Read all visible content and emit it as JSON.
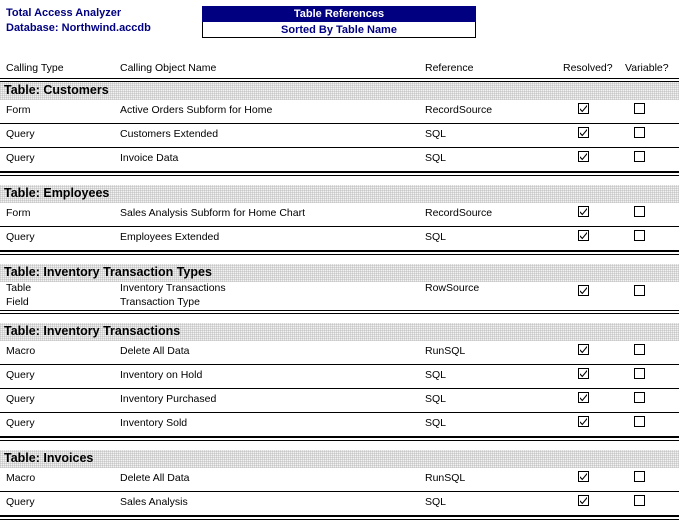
{
  "header": {
    "product": "Total Access Analyzer",
    "database": "Database: Northwind.accdb",
    "title": "Table References",
    "subtitle": "Sorted By Table Name"
  },
  "colors": {
    "accent": "#000080",
    "band": "#f2f2f2",
    "text": "#000000"
  },
  "columns": {
    "calling_type": "Calling Type",
    "calling_object_name": "Calling Object Name",
    "reference": "Reference",
    "resolved": "Resolved?",
    "variable": "Variable?"
  },
  "groups": [
    {
      "title": "Table: Customers",
      "rows": [
        {
          "type": "Form",
          "name": "Active Orders Subform for Home",
          "reference": "RecordSource",
          "resolved": true,
          "variable": false,
          "show_checks": true,
          "divider": true
        },
        {
          "type": "Query",
          "name": "Customers Extended",
          "reference": "SQL",
          "resolved": true,
          "variable": false,
          "show_checks": true,
          "divider": true
        },
        {
          "type": "Query",
          "name": "Invoice Data",
          "reference": "SQL",
          "resolved": true,
          "variable": false,
          "show_checks": true,
          "divider": true
        }
      ]
    },
    {
      "title": "Table: Employees",
      "rows": [
        {
          "type": "Form",
          "name": "Sales Analysis Subform for Home Chart",
          "reference": "RecordSource",
          "resolved": true,
          "variable": false,
          "show_checks": true,
          "divider": true
        },
        {
          "type": "Query",
          "name": "Employees Extended",
          "reference": "SQL",
          "resolved": true,
          "variable": false,
          "show_checks": true,
          "divider": true
        }
      ]
    },
    {
      "title": "Table: Inventory Transaction Types",
      "rows": [
        {
          "type": "Table",
          "name": "Inventory Transactions",
          "reference": "RowSource",
          "resolved": true,
          "variable": false,
          "show_checks": true,
          "divider": false,
          "tight": true
        },
        {
          "type": "Field",
          "name": "Transaction Type",
          "reference": "",
          "resolved": false,
          "variable": false,
          "show_checks": false,
          "divider": false,
          "tight": true
        }
      ]
    },
    {
      "title": "Table: Inventory Transactions",
      "rows": [
        {
          "type": "Macro",
          "name": "Delete All Data",
          "reference": "RunSQL",
          "resolved": true,
          "variable": false,
          "show_checks": true,
          "divider": true
        },
        {
          "type": "Query",
          "name": "Inventory on Hold",
          "reference": "SQL",
          "resolved": true,
          "variable": false,
          "show_checks": true,
          "divider": true
        },
        {
          "type": "Query",
          "name": "Inventory Purchased",
          "reference": "SQL",
          "resolved": true,
          "variable": false,
          "show_checks": true,
          "divider": true
        },
        {
          "type": "Query",
          "name": "Inventory Sold",
          "reference": "SQL",
          "resolved": true,
          "variable": false,
          "show_checks": true,
          "divider": true
        }
      ]
    },
    {
      "title": "Table: Invoices",
      "rows": [
        {
          "type": "Macro",
          "name": "Delete All Data",
          "reference": "RunSQL",
          "resolved": true,
          "variable": false,
          "show_checks": true,
          "divider": true
        },
        {
          "type": "Query",
          "name": "Sales Analysis",
          "reference": "SQL",
          "resolved": true,
          "variable": false,
          "show_checks": true,
          "divider": true
        }
      ]
    }
  ]
}
